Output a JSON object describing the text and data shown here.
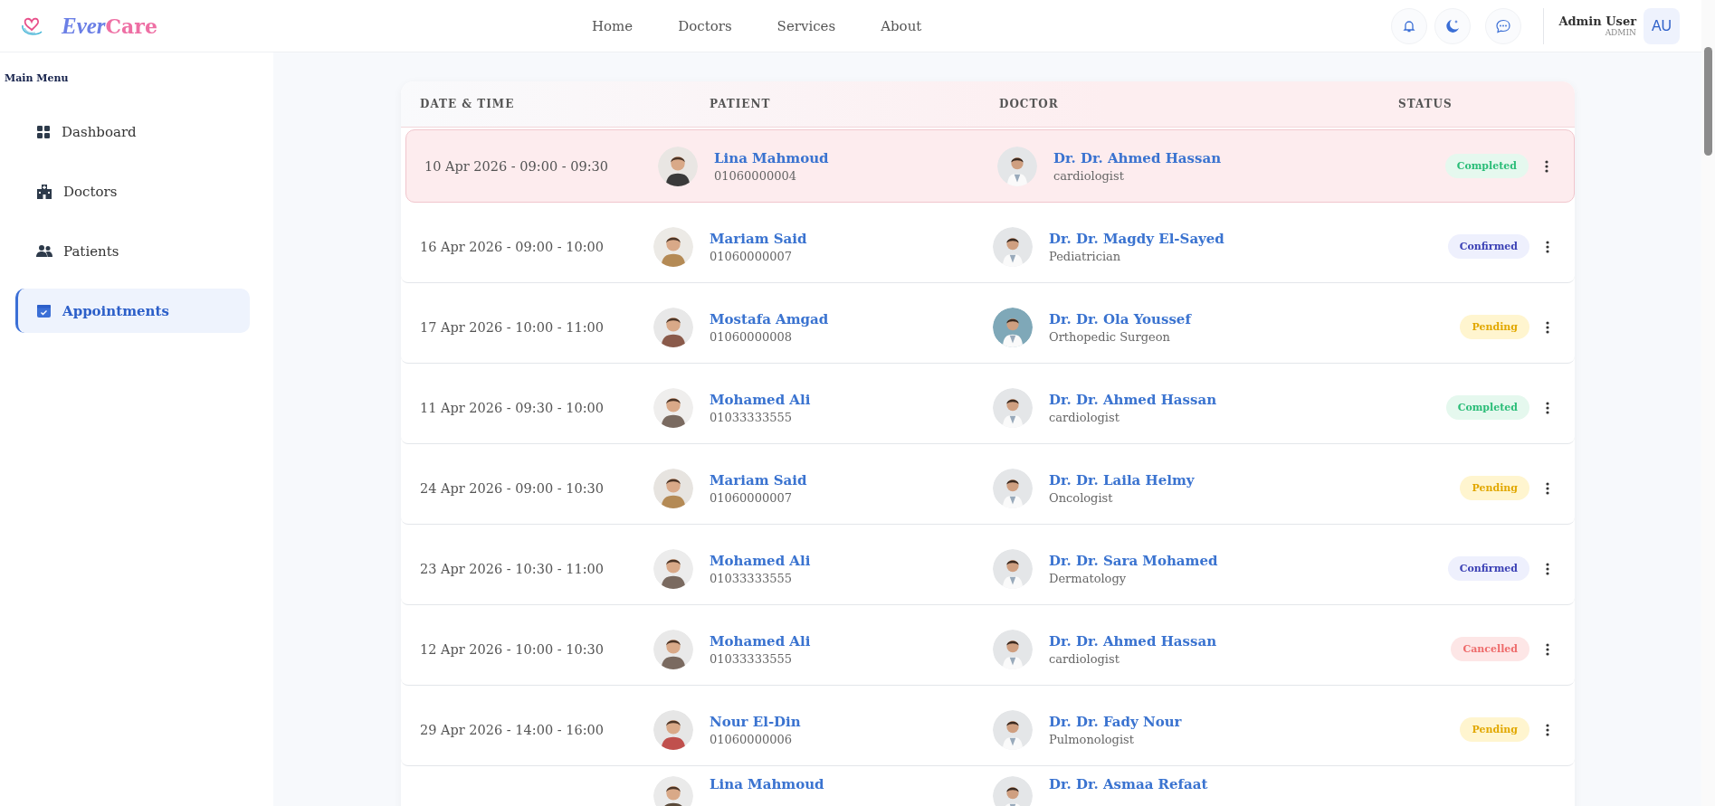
{
  "brand": {
    "first": "Ever",
    "second": "Care"
  },
  "nav": [
    "Home",
    "Doctors",
    "Services",
    "About"
  ],
  "user": {
    "name": "Admin User",
    "role": "ADMIN",
    "initials": "AU"
  },
  "sidebar": {
    "title": "Main Menu",
    "items": [
      {
        "label": "Dashboard",
        "kind": "dashboard",
        "selected": false
      },
      {
        "label": "Doctors",
        "kind": "doctors",
        "selected": false
      },
      {
        "label": "Patients",
        "kind": "patients",
        "selected": false
      },
      {
        "label": "Appointments",
        "kind": "appointments",
        "selected": true
      }
    ]
  },
  "table": {
    "columns": [
      "DATE & TIME",
      "PATIENT",
      "DOCTOR",
      "STATUS"
    ],
    "rows": [
      {
        "datetime": "10 Apr 2026 - 09:00 - 09:30",
        "patient": "Lina Mahmoud",
        "phone": "01060000004",
        "doctor": "Dr. Dr. Ahmed Hassan",
        "specialty": "cardiologist",
        "status": {
          "label": "Completed",
          "kind": "completed"
        },
        "selected": true
      },
      {
        "datetime": "16 Apr 2026 - 09:00 - 10:00",
        "patient": "Mariam Said",
        "phone": "01060000007",
        "doctor": "Dr. Dr. Magdy El-Sayed",
        "specialty": "Pediatrician",
        "status": {
          "label": "Confirmed",
          "kind": "confirmed"
        },
        "selected": false
      },
      {
        "datetime": "17 Apr 2026 - 10:00 - 11:00",
        "patient": "Mostafa Amgad",
        "phone": "01060000008",
        "doctor": "Dr. Dr. Ola Youssef",
        "specialty": "Orthopedic Surgeon",
        "status": {
          "label": "Pending",
          "kind": "pending"
        },
        "selected": false
      },
      {
        "datetime": "11 Apr 2026 - 09:30 - 10:00",
        "patient": "Mohamed Ali",
        "phone": "01033333555",
        "doctor": "Dr. Dr. Ahmed Hassan",
        "specialty": "cardiologist",
        "status": {
          "label": "Completed",
          "kind": "completed"
        },
        "selected": false
      },
      {
        "datetime": "24 Apr 2026 - 09:00 - 10:30",
        "patient": "Mariam Said",
        "phone": "01060000007",
        "doctor": "Dr. Dr. Laila Helmy",
        "specialty": "Oncologist",
        "status": {
          "label": "Pending",
          "kind": "pending"
        },
        "selected": false
      },
      {
        "datetime": "23 Apr 2026 - 10:30 - 11:00",
        "patient": "Mohamed Ali",
        "phone": "01033333555",
        "doctor": "Dr. Dr. Sara Mohamed",
        "specialty": "Dermatology",
        "status": {
          "label": "Confirmed",
          "kind": "confirmed"
        },
        "selected": false
      },
      {
        "datetime": "12 Apr 2026 - 10:00 - 10:30",
        "patient": "Mohamed Ali",
        "phone": "01033333555",
        "doctor": "Dr. Dr. Ahmed Hassan",
        "specialty": "cardiologist",
        "status": {
          "label": "Cancelled",
          "kind": "cancelled"
        },
        "selected": false
      },
      {
        "datetime": "29 Apr 2026 - 14:00 - 16:00",
        "patient": "Nour El-Din",
        "phone": "01060000006",
        "doctor": "Dr. Dr. Fady Nour",
        "specialty": "Pulmonologist",
        "status": {
          "label": "Pending",
          "kind": "pending"
        },
        "selected": false
      },
      {
        "patient": "Lina Mahmoud",
        "doctor": "Dr. Dr. Asmaa Refaat",
        "selected": false
      }
    ]
  }
}
